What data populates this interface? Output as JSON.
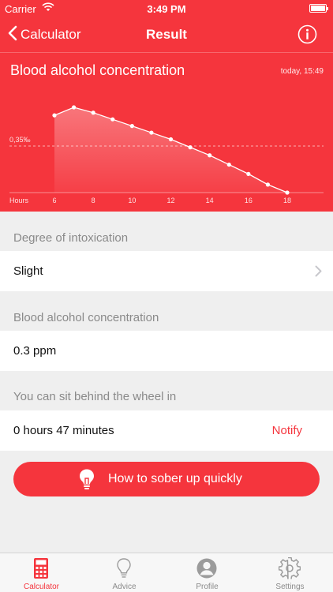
{
  "status_bar": {
    "carrier": "Carrier",
    "time": "3:49 PM"
  },
  "nav": {
    "back_label": "Calculator",
    "title": "Result"
  },
  "chart_header": {
    "title": "Blood alcohol concentration",
    "timestamp": "today, 15:49"
  },
  "chart_data": {
    "type": "area",
    "title": "",
    "xlabel": "Hours",
    "ylabel": "",
    "x_ticks": [
      6,
      8,
      10,
      12,
      14,
      16,
      18
    ],
    "xlim": [
      6,
      18
    ],
    "ylim": [
      0,
      0.64
    ],
    "threshold": {
      "value": 0.35,
      "label": "0,35‰"
    },
    "x": [
      6,
      7,
      8,
      9,
      10,
      11,
      12,
      13,
      14,
      15,
      16,
      17,
      18
    ],
    "values": [
      0.58,
      0.64,
      0.6,
      0.55,
      0.5,
      0.45,
      0.4,
      0.34,
      0.28,
      0.21,
      0.14,
      0.06,
      0.0
    ],
    "colors": {
      "line": "#ffffff",
      "area": "#ffffff"
    }
  },
  "sections": {
    "intoxication": {
      "header": "Degree of intoxication",
      "value": "Slight"
    },
    "concentration": {
      "header": "Blood alcohol concentration",
      "value": "0.3 ppm"
    },
    "driving": {
      "header": "You can sit behind the wheel in",
      "value": "0 hours 47 minutes",
      "action": "Notify"
    }
  },
  "cta": {
    "label": "How to sober up quickly"
  },
  "tabs": [
    {
      "label": "Calculator",
      "icon": "calculator-icon",
      "active": true
    },
    {
      "label": "Advice",
      "icon": "lightbulb-icon",
      "active": false
    },
    {
      "label": "Profile",
      "icon": "profile-icon",
      "active": false
    },
    {
      "label": "Settings",
      "icon": "gear-icon",
      "active": false
    }
  ],
  "colors": {
    "accent": "#f5353d",
    "background": "#efefef",
    "muted_text": "#8a8a8a"
  }
}
